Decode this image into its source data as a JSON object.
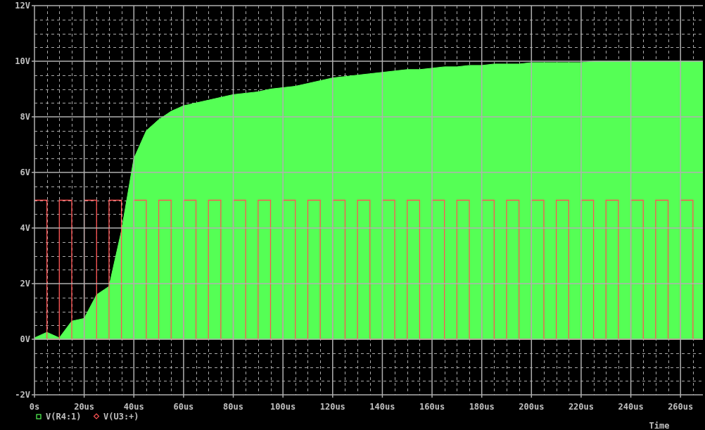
{
  "plot": {
    "chart_data": {
      "type": "area",
      "grid": true,
      "legend": "bottom-left",
      "xlabel": "Time",
      "x": [
        0,
        5,
        5,
        10,
        10,
        15,
        15,
        20,
        20,
        25,
        25,
        30,
        30,
        35,
        35,
        40,
        40,
        45,
        45,
        50,
        50,
        55,
        55,
        60,
        60,
        65,
        65,
        70,
        70,
        75,
        75,
        80,
        80,
        85,
        85,
        90,
        90,
        95,
        95,
        100,
        100,
        105,
        105,
        110,
        110,
        115,
        115,
        120,
        120,
        125,
        125,
        130,
        130,
        135,
        135,
        140,
        140,
        145,
        145,
        150,
        150,
        155,
        155,
        160,
        160,
        165,
        165,
        170,
        170,
        175,
        175,
        180,
        180,
        185,
        185,
        190,
        190,
        195,
        195,
        200,
        200,
        205,
        205,
        210,
        210,
        215,
        215,
        220,
        220,
        225,
        225,
        230,
        230,
        235,
        235,
        240,
        240,
        245,
        245,
        250,
        250,
        255,
        255,
        260,
        260,
        265,
        265,
        269
      ],
      "xlim": [
        0,
        269
      ],
      "ylim": [
        -2,
        12
      ],
      "xticks": [
        {
          "value": 0,
          "label": "0s"
        },
        {
          "value": 20,
          "label": "20us"
        },
        {
          "value": 40,
          "label": "40us"
        },
        {
          "value": 60,
          "label": "60us"
        },
        {
          "value": 80,
          "label": "80us"
        },
        {
          "value": 100,
          "label": "100us"
        },
        {
          "value": 120,
          "label": "120us"
        },
        {
          "value": 140,
          "label": "140us"
        },
        {
          "value": 160,
          "label": "160us"
        },
        {
          "value": 180,
          "label": "180us"
        },
        {
          "value": 200,
          "label": "200us"
        },
        {
          "value": 220,
          "label": "220us"
        },
        {
          "value": 240,
          "label": "240us"
        },
        {
          "value": 260,
          "label": "260us"
        }
      ],
      "yticks": [
        {
          "value": -2,
          "label": "-2V"
        },
        {
          "value": 0,
          "label": "0V"
        },
        {
          "value": 2,
          "label": "2V"
        },
        {
          "value": 4,
          "label": "4V"
        },
        {
          "value": 6,
          "label": "6V"
        },
        {
          "value": 8,
          "label": "8V"
        },
        {
          "value": 10,
          "label": "10V"
        },
        {
          "value": 12,
          "label": "12V"
        }
      ],
      "series": [
        {
          "name": "V(R4:1)",
          "type": "area",
          "color": "#55ff55",
          "values": [
            0.05,
            0.25,
            0.25,
            0.05,
            0.05,
            0.65,
            0.65,
            0.75,
            0.75,
            1.6,
            1.6,
            1.9,
            1.9,
            3.9,
            3.9,
            6.5,
            6.5,
            7.5,
            7.5,
            7.9,
            7.9,
            8.2,
            8.2,
            8.4,
            8.4,
            8.5,
            8.5,
            8.6,
            8.6,
            8.7,
            8.7,
            8.8,
            8.8,
            8.85,
            8.85,
            8.9,
            8.9,
            9,
            9,
            9.05,
            9.05,
            9.1,
            9.1,
            9.2,
            9.2,
            9.3,
            9.3,
            9.4,
            9.4,
            9.45,
            9.45,
            9.5,
            9.5,
            9.55,
            9.55,
            9.6,
            9.6,
            9.65,
            9.65,
            9.7,
            9.7,
            9.7,
            9.7,
            9.75,
            9.75,
            9.8,
            9.8,
            9.8,
            9.8,
            9.85,
            9.85,
            9.85,
            9.85,
            9.9,
            9.9,
            9.9,
            9.9,
            9.9,
            9.9,
            9.95,
            9.95,
            9.95,
            9.95,
            9.95,
            9.95,
            9.95,
            9.95,
            9.95,
            9.95,
            10,
            10,
            10,
            10,
            10,
            10,
            10,
            10,
            10,
            10,
            10,
            10,
            10,
            10,
            10,
            10,
            10,
            10,
            10
          ]
        },
        {
          "name": "V(U3:+)",
          "type": "line",
          "color": "#ff5555",
          "values": [
            5,
            5,
            0,
            0,
            5,
            5,
            0,
            0,
            5,
            5,
            0,
            0,
            5,
            5,
            0,
            0,
            5,
            5,
            0,
            0,
            5,
            5,
            0,
            0,
            5,
            5,
            0,
            0,
            5,
            5,
            0,
            0,
            5,
            5,
            0,
            0,
            5,
            5,
            0,
            0,
            5,
            5,
            0,
            0,
            5,
            5,
            0,
            0,
            5,
            5,
            0,
            0,
            5,
            5,
            0,
            0,
            5,
            5,
            0,
            0,
            5,
            5,
            0,
            0,
            5,
            5,
            0,
            0,
            5,
            5,
            0,
            0,
            5,
            5,
            0,
            0,
            5,
            5,
            0,
            0,
            5,
            5,
            0,
            0,
            5,
            5,
            0,
            0,
            5,
            5,
            0,
            0,
            5,
            5,
            0,
            0,
            5,
            5,
            0,
            0,
            5,
            5,
            0,
            0,
            5,
            5,
            0,
            0
          ]
        }
      ]
    }
  }
}
